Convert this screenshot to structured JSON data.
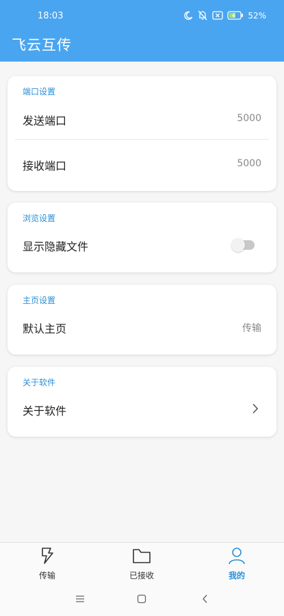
{
  "status": {
    "time": "18:03",
    "battery": "52%"
  },
  "app": {
    "title": "飞云互传"
  },
  "port_settings": {
    "header": "端口设置",
    "send_label": "发送端口",
    "send_value": "5000",
    "receive_label": "接收端口",
    "receive_value": "5000"
  },
  "browse_settings": {
    "header": "浏览设置",
    "show_hidden_label": "显示隐藏文件",
    "show_hidden_enabled": false
  },
  "home_settings": {
    "header": "主页设置",
    "default_home_label": "默认主页",
    "default_home_value": "传输"
  },
  "about": {
    "header": "关于软件",
    "about_label": "关于软件"
  },
  "nav": {
    "items": [
      {
        "label": "传输",
        "icon": "lightning-icon",
        "active": false
      },
      {
        "label": "已接收",
        "icon": "folder-icon",
        "active": false
      },
      {
        "label": "我的",
        "icon": "person-icon",
        "active": true
      }
    ]
  },
  "colors": {
    "primary": "#4aa5f0",
    "accent_text": "#2a8fd6",
    "background": "#f6f6f6"
  }
}
